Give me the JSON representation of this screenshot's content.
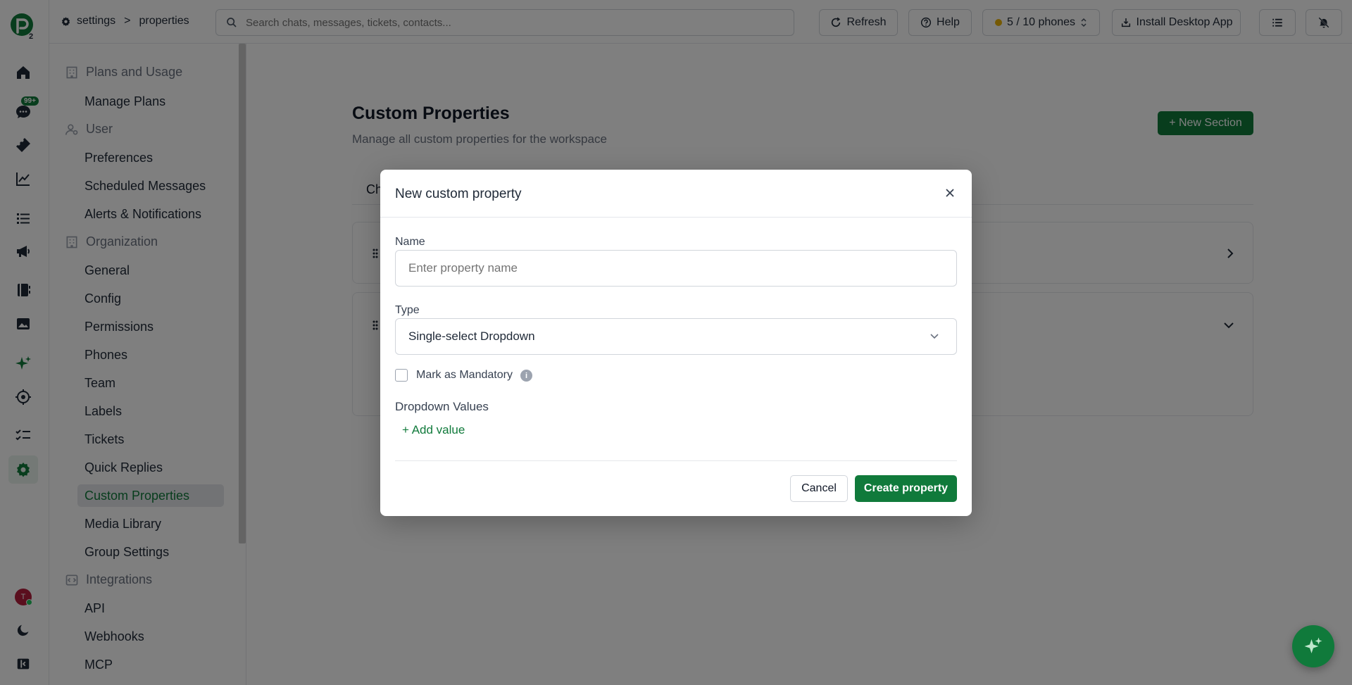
{
  "app": {
    "logo_icon": "brand-logo-icon",
    "logo_badge": "2",
    "brand_color": "#107a3b"
  },
  "rail": {
    "chat_badge": "99+",
    "avatar_initial": "T",
    "icons": [
      "home-icon",
      "chat-icon",
      "ticket-icon",
      "analytics-icon",
      "list-icon",
      "broadcast-icon",
      "contacts-icon",
      "media-icon",
      "ai-sparkle-icon",
      "automation-icon",
      "tasks-icon",
      "settings-icon",
      "theme-moon-icon",
      "collapse-icon"
    ]
  },
  "topbar": {
    "breadcrumb": {
      "root": "settings",
      "separator": ">",
      "current": "properties"
    },
    "search_placeholder": "Search chats, messages, tickets, contacts...",
    "refresh_label": "Refresh",
    "help_label": "Help",
    "phones_label": "5 / 10 phones",
    "install_label": "Install Desktop App"
  },
  "sidebar": {
    "sections": [
      {
        "title": "Plans and Usage",
        "items": [
          "Manage Plans"
        ]
      },
      {
        "title": "User",
        "items": [
          "Preferences",
          "Scheduled Messages",
          "Alerts & Notifications"
        ]
      },
      {
        "title": "Organization",
        "items": [
          "General",
          "Config",
          "Permissions",
          "Phones",
          "Team",
          "Labels",
          "Tickets",
          "Quick Replies",
          "Custom Properties",
          "Media Library",
          "Group Settings"
        ]
      },
      {
        "title": "Integrations",
        "items": [
          "API",
          "Webhooks",
          "MCP"
        ]
      }
    ],
    "active_item": "Custom Properties"
  },
  "page": {
    "title": "Custom Properties",
    "subtitle": "Manage all custom properties for the workspace",
    "new_section_label": "+ New Section",
    "tab_label": "Ch"
  },
  "modal": {
    "title": "New custom property",
    "name_label": "Name",
    "name_placeholder": "Enter property name",
    "type_label": "Type",
    "type_value": "Single-select Dropdown",
    "mandatory_label": "Mark as Mandatory",
    "mandatory_checked": false,
    "dropdown_values_label": "Dropdown Values",
    "add_value_label": "+ Add value",
    "cancel_label": "Cancel",
    "create_label": "Create property"
  }
}
